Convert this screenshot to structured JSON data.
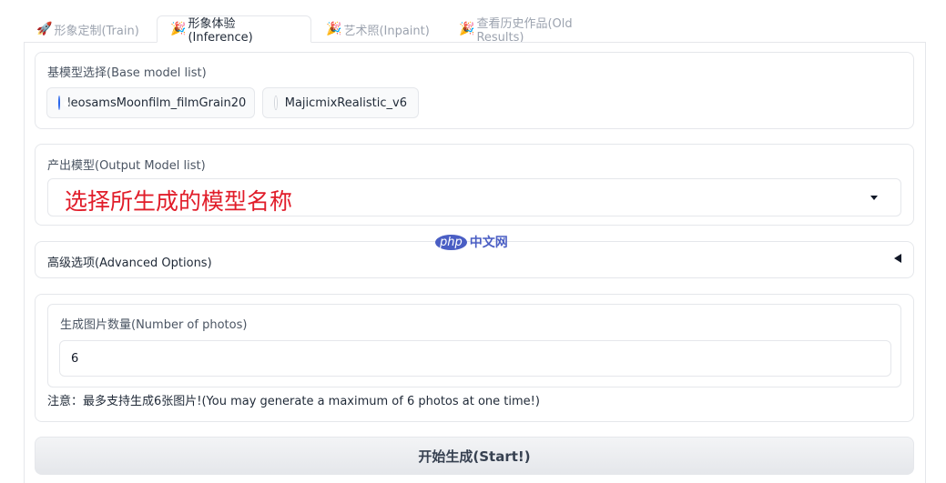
{
  "tabs": [
    {
      "emoji": "🚀",
      "label": "形象定制(Train)"
    },
    {
      "emoji": "🎉",
      "label": "形象体验(Inference)"
    },
    {
      "emoji": "🎉",
      "label": "艺术照(Inpaint)"
    },
    {
      "emoji": "🎉",
      "label": "查看历史作品(Old Results)"
    }
  ],
  "active_tab": 1,
  "base_model": {
    "label": "基模型选择(Base model list)",
    "options": [
      "leosamsMoonfilm_filmGrain20",
      "MajicmixRealistic_v6"
    ],
    "selected": "leosamsMoonfilm_filmGrain20"
  },
  "output_model": {
    "label": "产出模型(Output Model list)",
    "value": "选择所生成的模型名称"
  },
  "advanced": {
    "label": "高级选项(Advanced Options)"
  },
  "num_photos": {
    "label": "生成图片数量(Number of photos)",
    "value": "6"
  },
  "note": "注意：最多支持生成6张图片!(You may generate a maximum of 6 photos at one time!)",
  "start_button": "开始生成(Start!)",
  "watermark": {
    "badge": "php",
    "text": "中文网"
  },
  "colors": {
    "accent": "#2563eb",
    "dropdown_text": "#e11d2a",
    "watermark": "#4a5ec4"
  }
}
